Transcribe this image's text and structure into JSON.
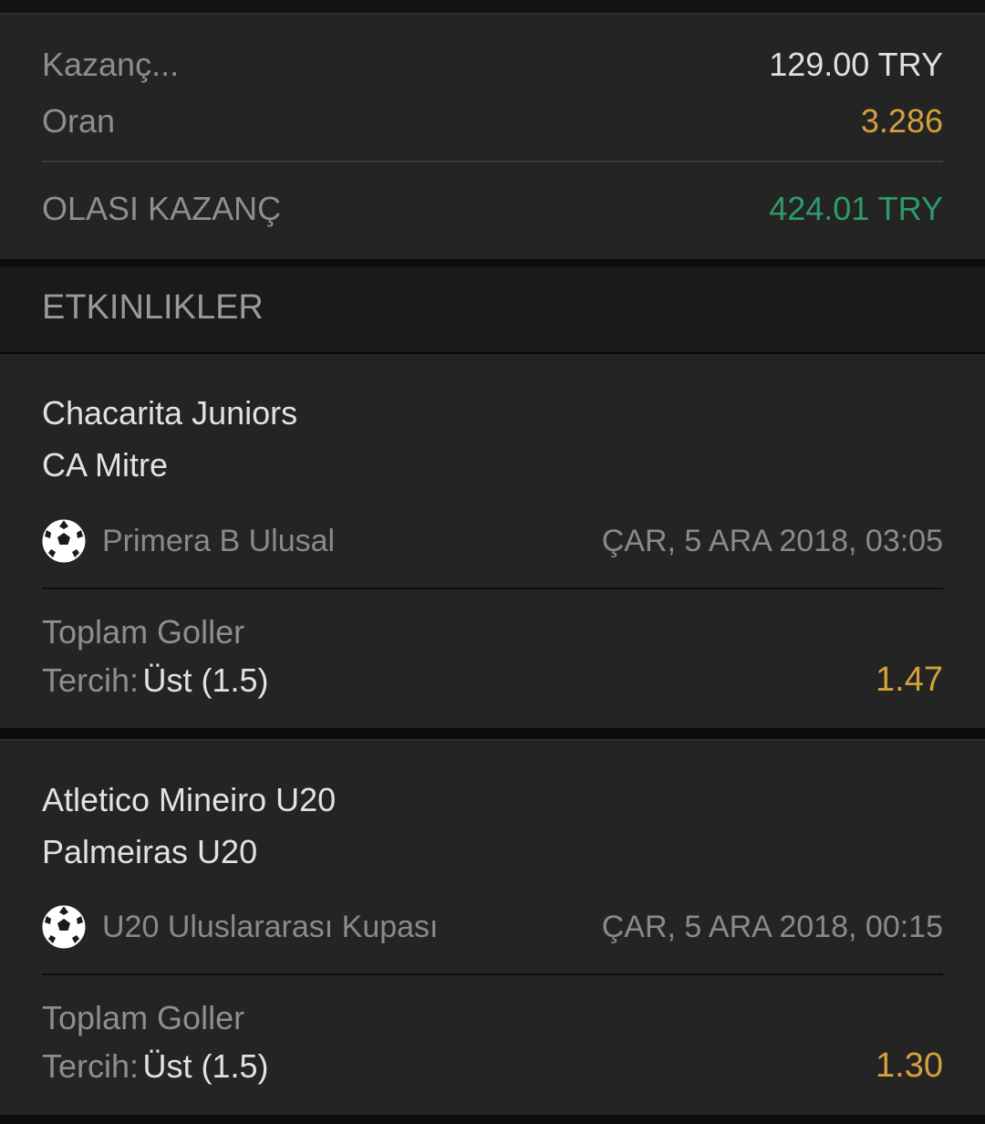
{
  "summary": {
    "stake_label": "Kazanç...",
    "stake_value": "129.00 TRY",
    "odds_label": "Oran",
    "odds_value": "3.286",
    "potential_label": "OLASI KAZANÇ",
    "potential_value": "424.01 TRY"
  },
  "events_header": "ETKINLIKLER",
  "events": [
    {
      "home": "Chacarita Juniors",
      "away": "CA Mitre",
      "sport_icon": "soccer-ball-icon",
      "league": "Primera B Ulusal",
      "datetime": "ÇAR, 5 ARA 2018, 03:05",
      "market": "Toplam Goller",
      "pick_label": "Tercih:",
      "pick_value": "Üst (1.5)",
      "odds": "1.47"
    },
    {
      "home": "Atletico Mineiro U20",
      "away": "Palmeiras U20",
      "sport_icon": "soccer-ball-icon",
      "league": "U20 Uluslararası Kupası",
      "datetime": "ÇAR, 5 ARA 2018, 00:15",
      "market": "Toplam Goller",
      "pick_label": "Tercih:",
      "pick_value": "Üst (1.5)",
      "odds": "1.30"
    }
  ],
  "colors": {
    "accent_orange": "#d4a03a",
    "win_green": "#2f9a6a",
    "card_bg": "#242424"
  }
}
